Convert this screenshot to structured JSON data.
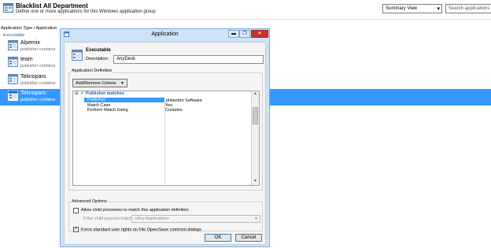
{
  "header": {
    "title": "Blacklist All Department",
    "subtitle": "Define one or more applications for this Windows application group",
    "view_select": "Summary View",
    "search_placeholder": "Search applications"
  },
  "list": {
    "column_header": "Application Type / Application",
    "group_label": "Executable",
    "items": [
      {
        "name": "Alpemix",
        "desc": "publisher contains",
        "selected": false
      },
      {
        "name": "team",
        "desc": "publisher contains",
        "selected": false
      },
      {
        "name": "Teknopars",
        "desc": "publisher contains",
        "selected": false
      },
      {
        "name": "Teknopars",
        "desc": "publisher contains",
        "selected": true
      }
    ]
  },
  "dialog": {
    "title": "Application",
    "titlebar_buttons": {
      "minimize": "▬",
      "restore": "❐",
      "close": "✕"
    },
    "executable_label": "Executable",
    "description_label": "Description:",
    "description_value": "AnyDesk",
    "app_definition_label": "Application Definition",
    "criteria_button": "Add/Remove Criteria",
    "grid": {
      "group_title": "Publisher matches",
      "rows": [
        {
          "key": "Publisher",
          "value": "philandro Software"
        },
        {
          "key": "Match Case",
          "value": "Yes"
        },
        {
          "key": "Perform Match Using",
          "value": "Contains"
        }
      ]
    },
    "advanced_label": "Advanced Options",
    "allow_child_label": "Allow child processes to match this application definition",
    "allow_child_checked": false,
    "child_match_label": "If the child process matches",
    "child_match_value": "<Any Application>",
    "force_rights_label": "Force standard user rights on File Open/Save common dialogs",
    "force_rights_checked": true,
    "ok_label": "OK",
    "cancel_label": "Cancel"
  },
  "colors": {
    "selection": "#3399ff",
    "dialog_frame": "#cfe3f7",
    "close_button": "#c9352a"
  }
}
